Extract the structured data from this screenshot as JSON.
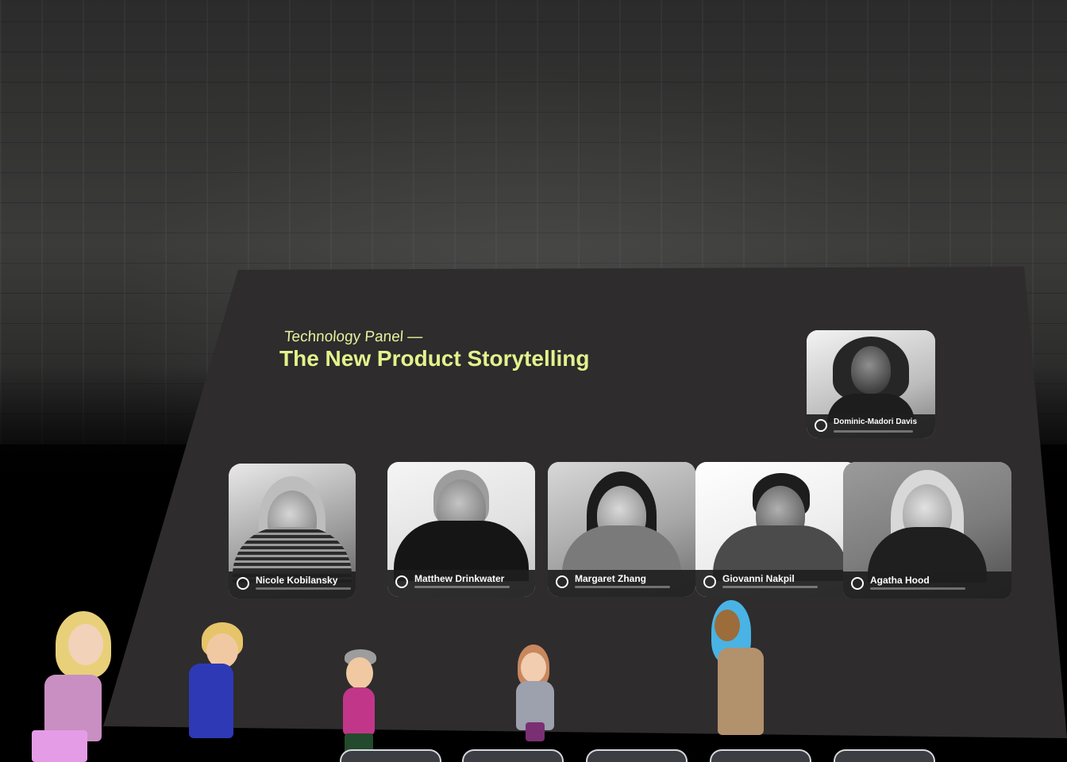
{
  "panel": {
    "subtitle": "Technology Panel —",
    "title": "The New Product Storytelling",
    "featured": {
      "name": "Dominic-Madori Davis"
    },
    "speakers": [
      {
        "name": "Nicole Kobilansky"
      },
      {
        "name": "Matthew Drinkwater"
      },
      {
        "name": "Margaret Zhang"
      },
      {
        "name": "Giovanni Nakpil"
      },
      {
        "name": "Agatha Hood"
      }
    ]
  },
  "colors": {
    "accent": "#e2f38c",
    "screen": "#2e2c2d",
    "wall": "#2b2b2b"
  },
  "bottom_bar": {
    "buttons": [
      "",
      "",
      "",
      "",
      ""
    ]
  }
}
